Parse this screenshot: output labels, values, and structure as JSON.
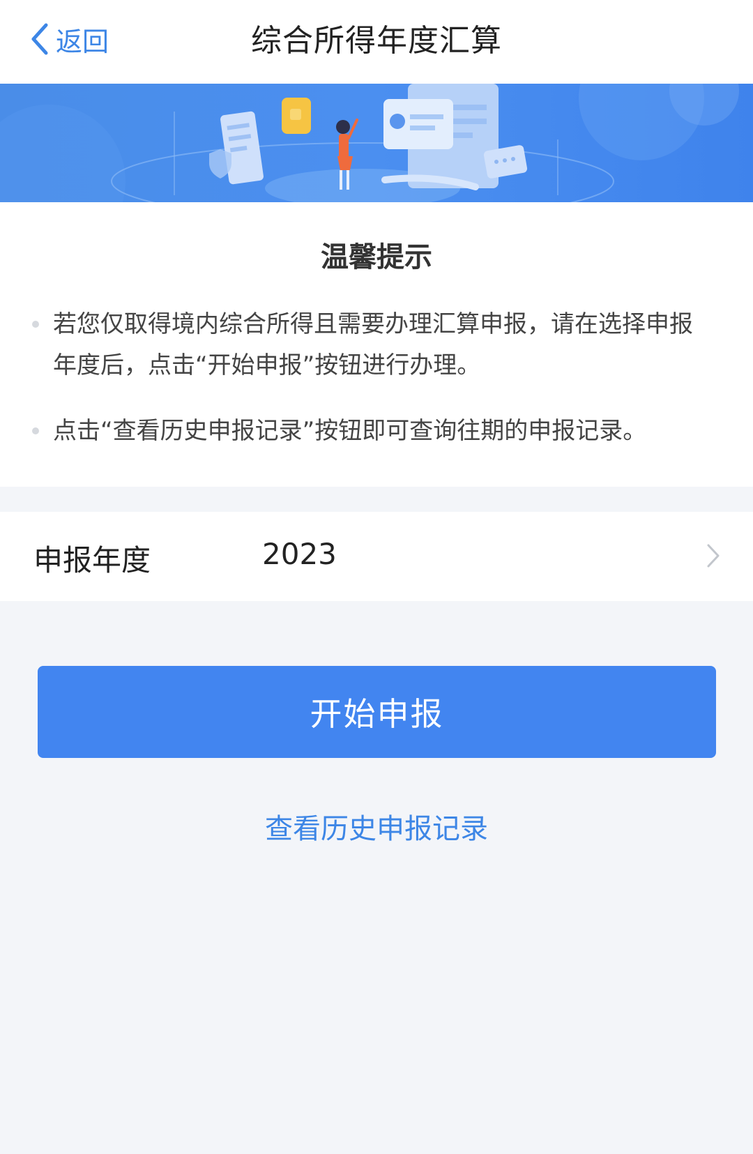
{
  "nav": {
    "back_label": "返回",
    "title": "综合所得年度汇算"
  },
  "notice": {
    "title": "温馨提示",
    "tips": [
      "若您仅取得境内综合所得且需要办理汇算申报，请在选择申报年度后，点击“开始申报”按钮进行办理。",
      "点击“查看历史申报记录”按钮即可查询往期的申报记录。"
    ]
  },
  "year_selector": {
    "label": "申报年度",
    "value": "2023"
  },
  "actions": {
    "start_label": "开始申报",
    "history_label": "查看历史申报记录"
  },
  "colors": {
    "accent": "#4285f0",
    "link": "#3d86e6",
    "page_bg": "#f3f5f9"
  },
  "icons": {
    "back": "chevron-left-icon",
    "year_arrow": "chevron-right-icon"
  }
}
